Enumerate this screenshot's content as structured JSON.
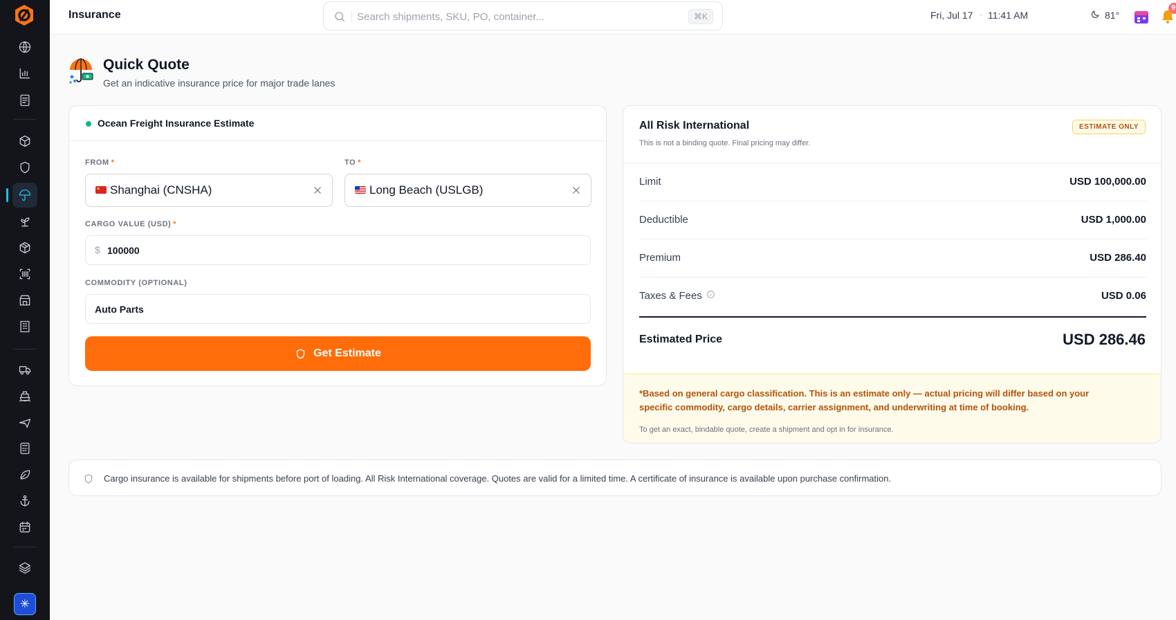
{
  "topbar": {
    "title": "Insurance",
    "search_placeholder": "Search shipments, SKU, PO, container...",
    "search_shortcut": "⌘K",
    "date": "Fri, Jul 17",
    "time": "11:41 AM",
    "temperature": "81°",
    "notification_count": "9+"
  },
  "sidebar": {
    "items": [
      "globe",
      "analytics",
      "documents",
      "packages",
      "shield",
      "insurance-umbrella",
      "sprout",
      "boxes",
      "scanner",
      "store",
      "buildings",
      "truck",
      "ship",
      "plane",
      "calculator",
      "leaf",
      "anchor",
      "calendar",
      "layers"
    ],
    "active": "insurance-umbrella"
  },
  "header": {
    "title": "Quick Quote",
    "subtitle": "Get an indicative insurance price for major trade lanes"
  },
  "form": {
    "card_title": "Ocean Freight Insurance Estimate",
    "from_label": "FROM",
    "from_value": "Shanghai (CNSHA)",
    "to_label": "TO",
    "to_value": "Long Beach (USLGB)",
    "required_mark": "*",
    "cargo_label": "CARGO VALUE (USD)",
    "currency_symbol": "$",
    "cargo_value": "100000",
    "commodity_label": "COMMODITY (OPTIONAL)",
    "commodity_value": "Auto Parts",
    "submit_label": "Get Estimate"
  },
  "result": {
    "title": "All Risk International",
    "subtitle": "This is not a binding quote. Final pricing may differ.",
    "badge": "ESTIMATE ONLY",
    "rows": [
      {
        "label": "Limit",
        "value": "USD 100,000.00"
      },
      {
        "label": "Deductible",
        "value": "USD 1,000.00"
      },
      {
        "label": "Premium",
        "value": "USD 286.40"
      },
      {
        "label": "Taxes & Fees",
        "value": "USD 0.06"
      }
    ],
    "total_label": "Estimated Price",
    "total_value": "USD 286.46",
    "warning": "*Based on general cargo classification. This is an estimate only — actual pricing will differ based on your specific commodity, cargo details, carrier assignment, and underwriting at time of booking.",
    "info": "To get an exact, bindable quote, create a shipment and opt in for insurance."
  },
  "banner": {
    "text": "Cargo insurance is available for shipments before port of loading. All Risk International coverage. Quotes are valid for a limited time. A certificate of insurance is available upon purchase confirmation."
  },
  "colors": {
    "accent": "#ff6d0a",
    "sidebar_bg": "#13151b",
    "active_nav": "#22c3e6",
    "status_dot": "#10b981",
    "warning_text": "#b45309"
  }
}
